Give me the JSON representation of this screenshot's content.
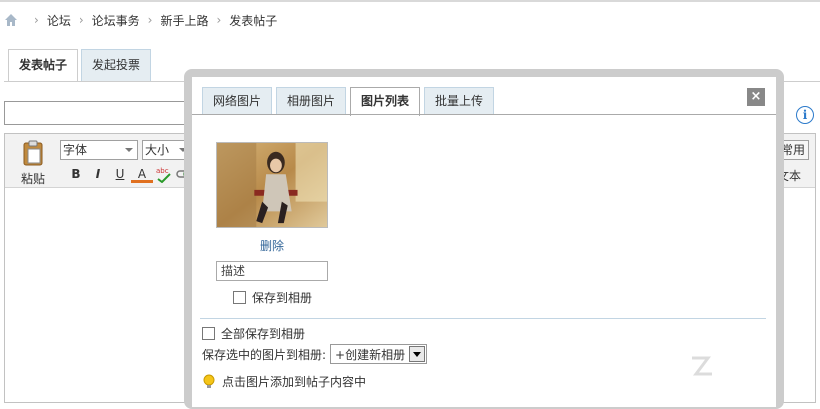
{
  "breadcrumb": {
    "items": [
      "论坛",
      "论坛事务",
      "新手上路",
      "发表帖子"
    ],
    "separator": "›"
  },
  "post_tabs": [
    {
      "label": "发表帖子",
      "active": true
    },
    {
      "label": "发起投票",
      "active": false
    }
  ],
  "editor": {
    "paste_label": "粘贴",
    "font_select": "字体",
    "size_select": "大小",
    "format_buttons": [
      "B",
      "I",
      "U",
      "A"
    ],
    "common_label": "常用",
    "text_label": "文本"
  },
  "dialog": {
    "tabs": [
      {
        "label": "网络图片",
        "active": false
      },
      {
        "label": "相册图片",
        "active": false
      },
      {
        "label": "图片列表",
        "active": true
      },
      {
        "label": "批量上传",
        "active": false
      }
    ],
    "close_label": "×",
    "image": {
      "delete_label": "删除",
      "description_value": "描述",
      "save_to_album_label": "保存到相册"
    },
    "save_all_label": "全部保存到相册",
    "save_selected_label": "保存选中的图片到相册:",
    "album_option": "+创建新相册",
    "hint": "点击图片添加到帖子内容中"
  },
  "info_icon_label": "i",
  "colors": {
    "tab_bg": "#e5edf2",
    "tab_border": "#c2d5e3",
    "link": "#336699",
    "dialog_frame": "#cccccc"
  }
}
